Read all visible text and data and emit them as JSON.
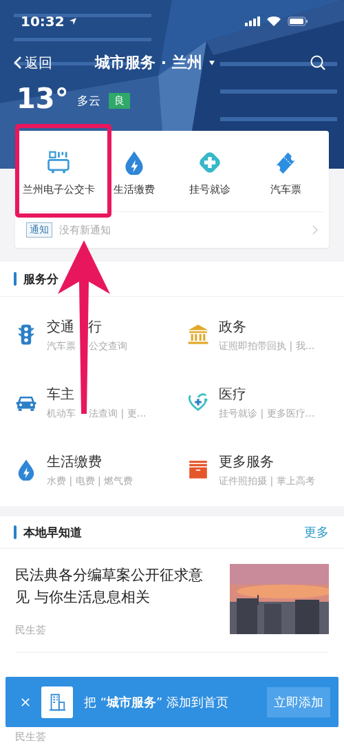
{
  "status_bar": {
    "time": "10:32"
  },
  "nav": {
    "back": "返回",
    "title": "城市服务 · 兰州"
  },
  "weather": {
    "temperature": "13°",
    "condition": "多云",
    "air_quality": "良"
  },
  "shortcuts": [
    {
      "label": "兰州电子公交卡",
      "kind": "bus-card"
    },
    {
      "label": "生活缴费",
      "kind": "utility"
    },
    {
      "label": "挂号就诊",
      "kind": "medical"
    },
    {
      "label": "汽车票",
      "kind": "ticket"
    }
  ],
  "notice": {
    "tag": "通知",
    "text": "没有新通知"
  },
  "services": {
    "title": "服务分",
    "items": [
      {
        "name": [
          "交通",
          "行"
        ],
        "detail": [
          "汽车票",
          "公交查询"
        ],
        "kind": "traffic"
      },
      {
        "name": [
          "政务"
        ],
        "detail": [
          "证照即拍带回执 | 我…"
        ],
        "kind": "government"
      },
      {
        "name": [
          "车主"
        ],
        "detail": [
          "机动车",
          "法查询 | 更…"
        ],
        "kind": "car"
      },
      {
        "name": [
          "医疗"
        ],
        "detail": [
          "挂号就诊 | 更多医疗…"
        ],
        "kind": "medical"
      },
      {
        "name": [
          "生活缴费"
        ],
        "detail": [
          "水费 | 电费 | 燃气费"
        ],
        "kind": "utility"
      },
      {
        "name": [
          "更多服务"
        ],
        "detail": [
          "证件照拍摄 | 掌上高考"
        ],
        "kind": "more"
      }
    ]
  },
  "news": {
    "title": "本地早知道",
    "more": "更多",
    "articles": [
      {
        "title": "民法典各分编草案公开征求意见 与你生活息息相关",
        "source": "民生荟"
      },
      {
        "source": "民生荟"
      }
    ]
  },
  "banner": {
    "text": "把 “**城市服务**” 添加到首页",
    "button": "立即添加"
  }
}
